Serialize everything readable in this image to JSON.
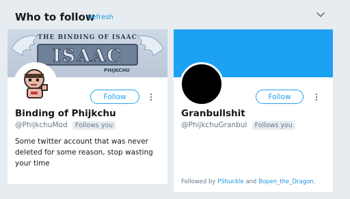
{
  "header": {
    "title": "Who to follow",
    "separator": "·",
    "refresh_label": "Refresh"
  },
  "cards": [
    {
      "banner_text": "THE BINDING OF ISAAC",
      "banner_subtext": "PHIJKCHU",
      "name": "Binding of Phijkchu",
      "handle": "@PhijkchuMod",
      "badge": "Follows you",
      "follow_label": "Follow",
      "bio": "Some twitter account that was never deleted for some reason, stop wasting your time"
    },
    {
      "name": "Granbullshit",
      "handle": "@PhijkchuGranbul",
      "badge": "Follows you",
      "follow_label": "Follow",
      "followed_by_prefix": "Followed by",
      "followed_by_1": "PShuckle",
      "followed_by_and": "and",
      "followed_by_2": "Bopen_the_Dragon",
      "followed_by_suffix": "."
    }
  ],
  "colors": {
    "accent": "#1da1f2",
    "link": "#1b95e0",
    "background": "#e6ecf0",
    "banner2": "#1da1f2"
  },
  "icons": {
    "collapse": "chevron-down-icon",
    "more": "more-vertical-icon"
  }
}
